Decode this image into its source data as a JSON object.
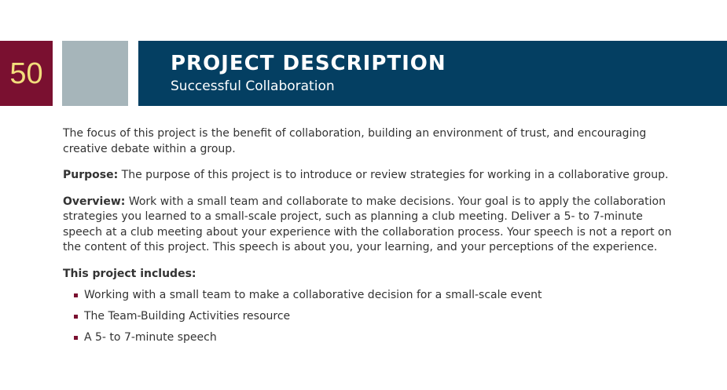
{
  "colors": {
    "page_number_bg": "#7a1030",
    "page_number_text": "#f2dd7c",
    "grey_block": "#a6b5ba",
    "header_band": "#043f62",
    "bullet": "#7a1030",
    "body_text": "#333333"
  },
  "page_number": "50",
  "header": {
    "title": "PROJECT DESCRIPTION",
    "subtitle": "Successful Collaboration"
  },
  "intro": "The focus of this project is the benefit of collaboration, building an environment of trust, and encouraging creative debate within a group.",
  "purpose": {
    "label": "Purpose:",
    "text": " The purpose of this project is to introduce or review strategies for working in a collaborative group."
  },
  "overview": {
    "label": "Overview:",
    "text": " Work with a small team and collaborate to make decisions. Your goal is to apply the collaboration strategies you learned to a small-scale project, such as planning a club meeting. Deliver a 5- to 7-minute speech at a club meeting about your experience with the collaboration process. Your speech is not a report on the content of this project. This speech is about you, your learning, and your perceptions of the experience."
  },
  "includes": {
    "heading": "This project includes:",
    "items": [
      "Working with a small team to make a collaborative decision for a small-scale event",
      "The Team-Building Activities resource",
      "A 5- to 7-minute speech"
    ]
  }
}
